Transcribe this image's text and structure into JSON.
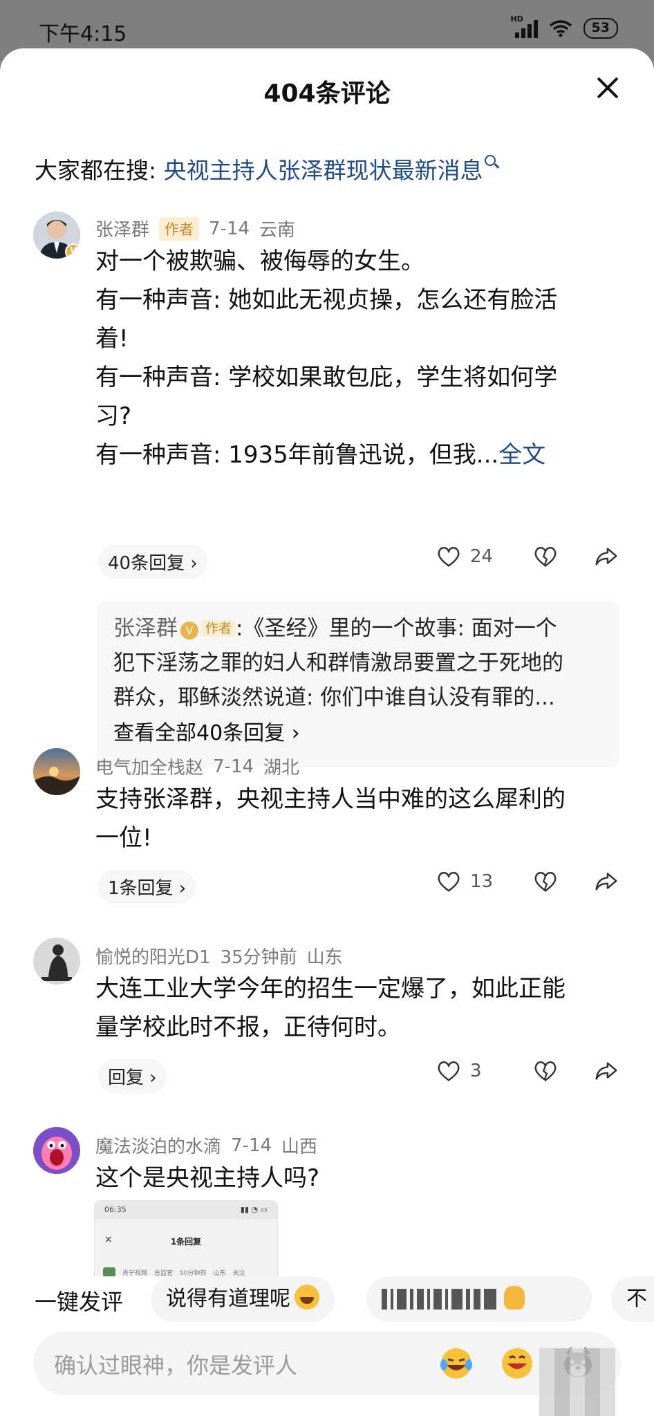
{
  "status_bar": {
    "time": "下午4:15",
    "network": "HD",
    "battery": "53"
  },
  "sheet": {
    "title": "404条评论"
  },
  "search_hint": {
    "label": "大家都在搜: ",
    "query": "央视主持人张泽群现状最新消息"
  },
  "comments": [
    {
      "author": "张泽群",
      "author_tag": "作者",
      "date": "7-14",
      "location": "云南",
      "lines": [
        "对一个被欺骗、被侮辱的女生。",
        "有一种声音: 她如此无视贞操，怎么还有脸活",
        "着!",
        "有一种声音: 学校如果敢包庇，学生将如何学",
        "习?",
        "有一种声音: 1935年前鲁迅说，但我..."
      ],
      "full_text_link": "全文",
      "reply_count": "40条回复",
      "likes": "24",
      "reply_preview": {
        "name": "张泽群",
        "tag": "作者",
        "line1": ":《圣经》里的一个故事: 面对一个",
        "line2": "犯下淫荡之罪的妇人和群情激昂要置之于死地的",
        "line3": "群众，耶稣淡然说道: 你们中谁自认没有罪的...",
        "view_all": "查看全部40条回复"
      }
    },
    {
      "author": "电气加全栈赵",
      "date": "7-14",
      "location": "湖北",
      "lines": [
        "支持张泽群，央视主持人当中难的这么犀利的",
        "一位!"
      ],
      "reply_count": "1条回复",
      "likes": "13"
    },
    {
      "author": "愉悦的阳光D1",
      "date": "35分钟前",
      "location": "山东",
      "lines": [
        "大连工业大学今年的招生一定爆了，如此正能",
        "量学校此时不报，正待何时。"
      ],
      "reply_count": "回复",
      "likes": "3"
    },
    {
      "author": "魔法淡泊的水滴",
      "date": "7-14",
      "location": "山西",
      "lines": [
        "这个是央视主持人吗?"
      ],
      "thumbnail": {
        "time": "06:35",
        "title": "1条回复",
        "close": "×",
        "row_a": "肖宁视频",
        "row_b": "总监官",
        "row_c": "50分钟前",
        "row_d": "山东",
        "row_e": "关注"
      }
    }
  ],
  "quick_bar": {
    "label": "一键发评",
    "chip1": "说得有道理呢",
    "chip2_suffix": "",
    "chip3": "不"
  },
  "input": {
    "placeholder": "确认过眼神，你是发评人"
  },
  "colors": {
    "link": "#1f4b8a",
    "author_tag_bg": "#fbeed3",
    "author_tag_text": "#c68a2b",
    "badge": "#e9b44c"
  }
}
